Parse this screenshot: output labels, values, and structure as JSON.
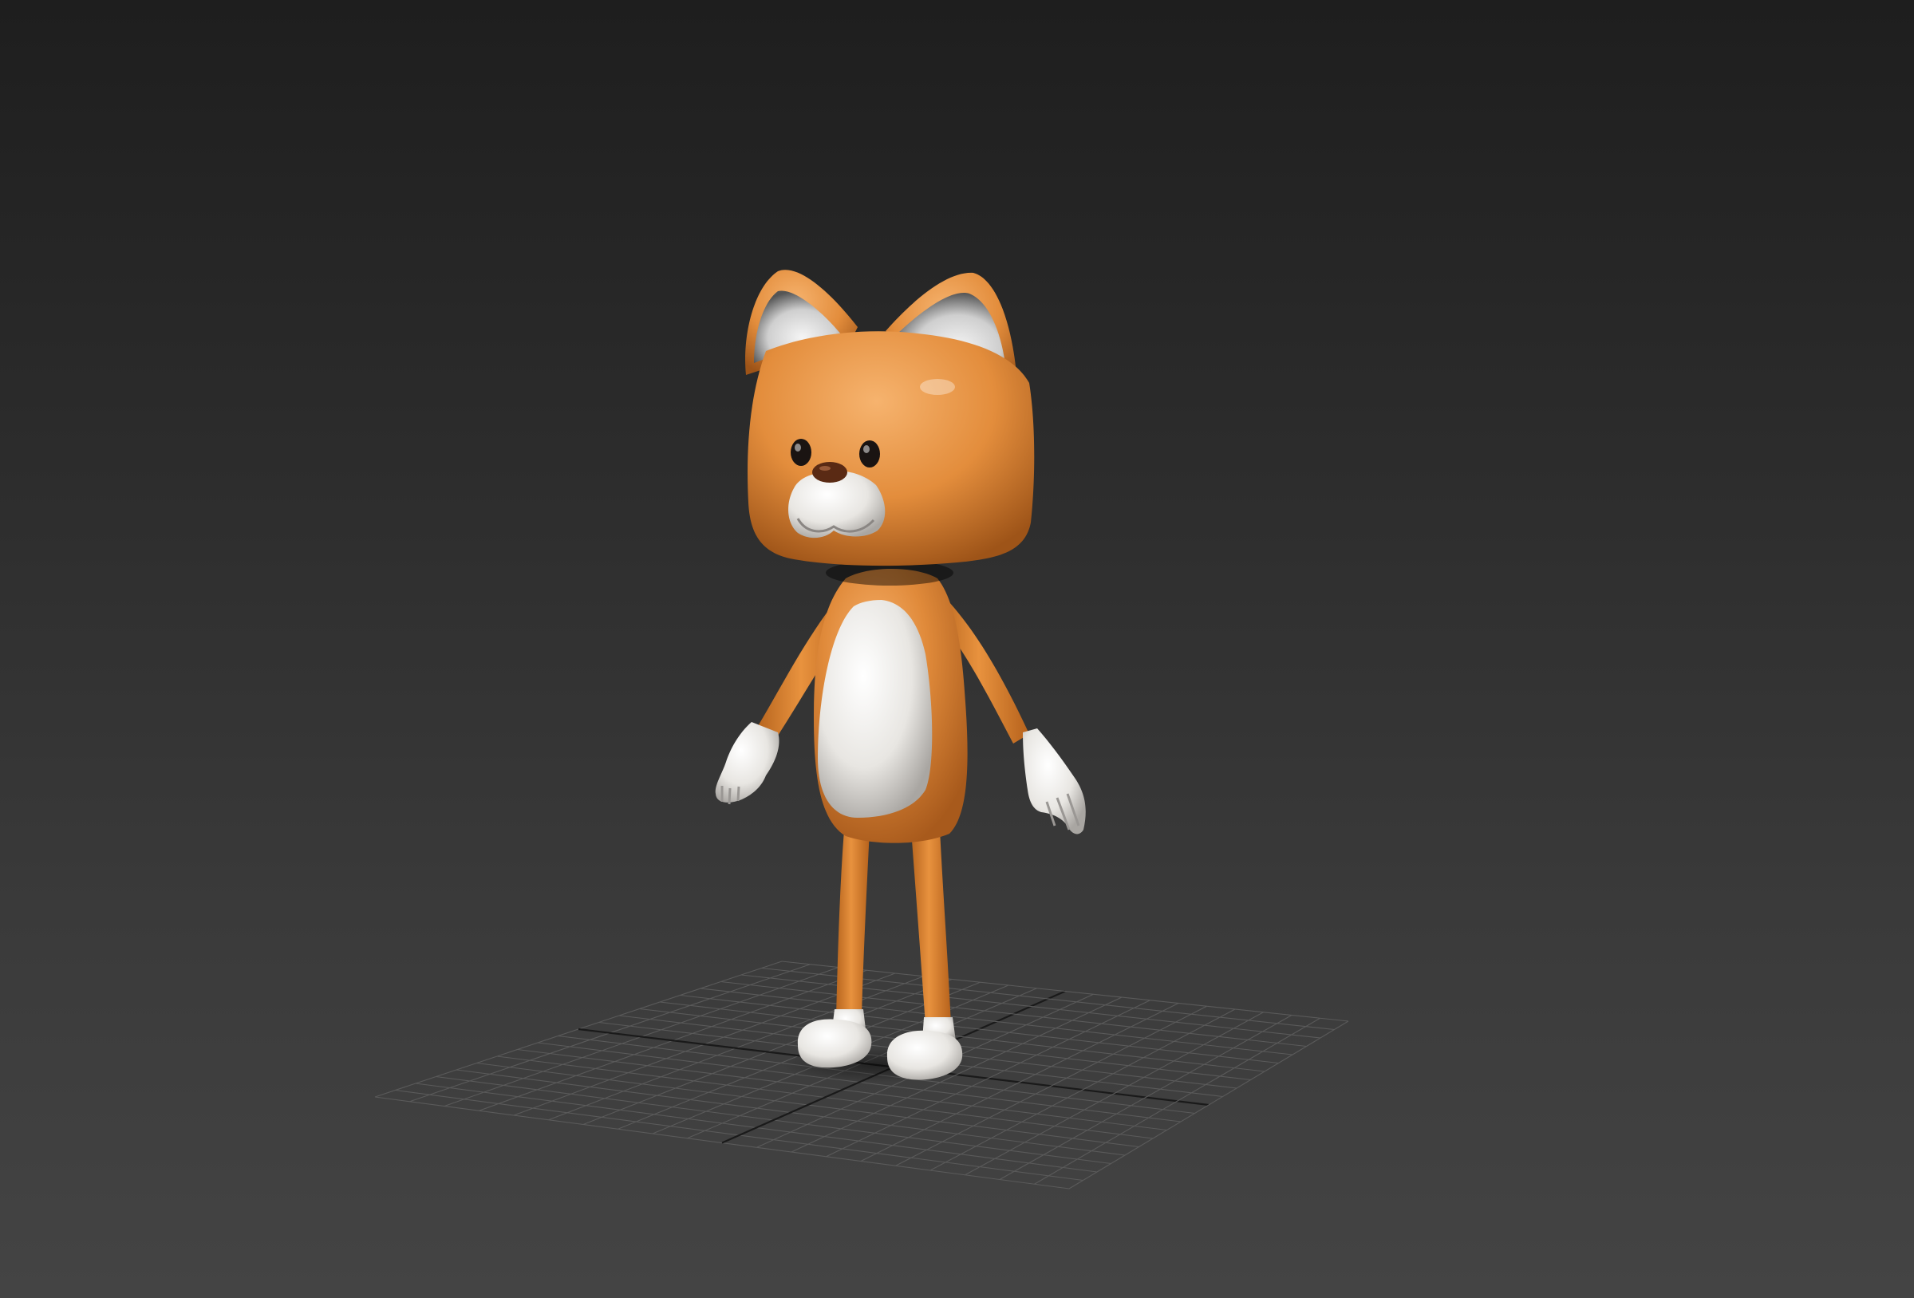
{
  "viewport": {
    "background_top": "#1e1e1e",
    "background_bottom": "#444444"
  },
  "grid": {
    "line_color": "#5a5a5a",
    "axis_color": "#1a1a1a"
  },
  "character": {
    "fur_color": "#e08a3a",
    "belly_color": "#e8e6e2",
    "eye_color": "#1a1412",
    "nose_color": "#5a2a14"
  }
}
